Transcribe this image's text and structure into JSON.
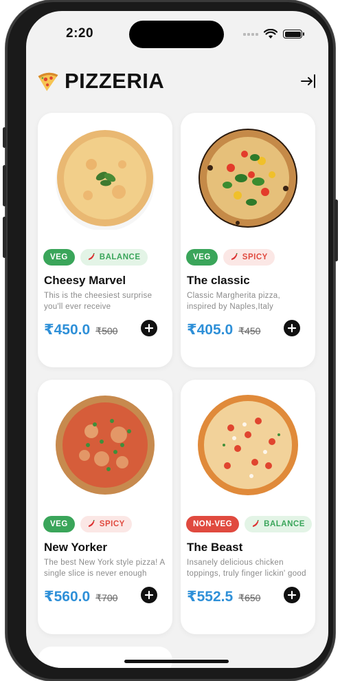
{
  "status": {
    "time": "2:20"
  },
  "header": {
    "brand": "PIZZERIA"
  },
  "products": [
    {
      "name": "Cheesy Marvel",
      "desc": "This is the cheesiest surprise you'll ever receive",
      "price": "₹450.0",
      "old_price": "₹500",
      "diet": "VEG",
      "taste": "BALANCE"
    },
    {
      "name": "The classic",
      "desc": "Classic Margherita pizza, inspired by Naples,Italy",
      "price": "₹405.0",
      "old_price": "₹450",
      "diet": "VEG",
      "taste": "SPICY"
    },
    {
      "name": "New Yorker",
      "desc": "The best New York style pizza! A single slice is never enough",
      "price": "₹560.0",
      "old_price": "₹700",
      "diet": "VEG",
      "taste": "SPICY"
    },
    {
      "name": "The Beast",
      "desc": "Insanely delicious chicken toppings, truly finger lickin' good",
      "price": "₹552.5",
      "old_price": "₹650",
      "diet": "NON-VEG",
      "taste": "BALANCE"
    }
  ],
  "colors": {
    "accent": "#2f90d8",
    "veg": "#3aa55a",
    "nonveg": "#e04a3f"
  }
}
